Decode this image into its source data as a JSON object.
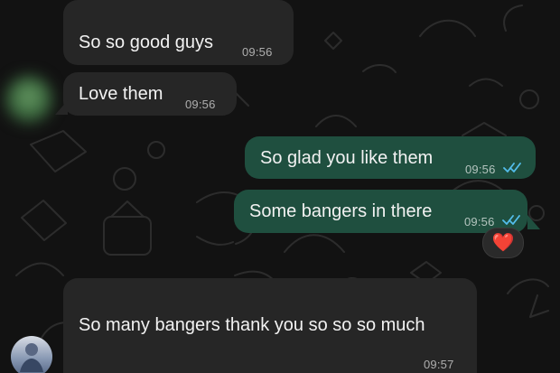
{
  "colors": {
    "background": "#121212",
    "incoming_bubble": "#262626",
    "outgoing_bubble": "#1f4f3f",
    "text": "#f2f2f2",
    "read_ticks": "#53bdeb",
    "heart": "#ff4d5a"
  },
  "messages": [
    {
      "text": "So so good guys",
      "time": "09:56"
    },
    {
      "text": "Love them",
      "time": "09:56"
    },
    {
      "text": "So glad you like them",
      "time": "09:56"
    },
    {
      "text": "Some bangers in there",
      "time": "09:56",
      "reaction": "❤️"
    },
    {
      "text": "So many bangers thank you so so so much",
      "time": "09:57"
    }
  ],
  "icons": {
    "read_receipt": "double-check-icon",
    "reaction": "heart-emoji"
  }
}
